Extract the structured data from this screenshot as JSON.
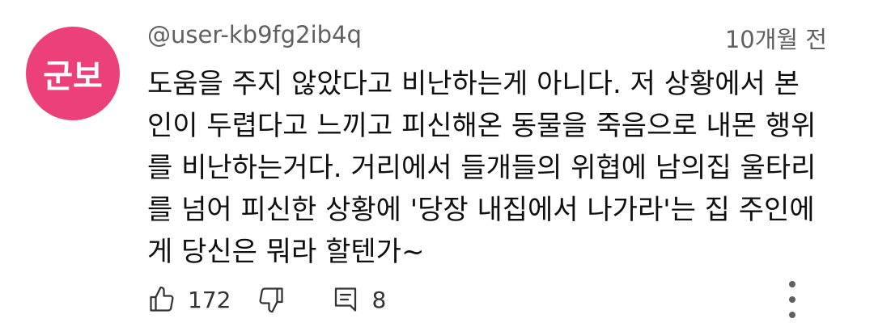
{
  "comment": {
    "avatar_text": "군보",
    "author": "@user-kb9fg2ib4q",
    "timestamp": "10개월 전",
    "lines": [
      "도움을 주지 않았다고 비난하는게 아니다. 저 상황에서 본",
      "인이 두렵다고 느끼고 피신해온 동물을 죽음으로 내몬 행위",
      "를 비난하는거다. 거리에서 들개들의 위협에 남의집 울타리",
      "를 넘어 피신한 상황에 '당장 내집에서 나가라'는 집 주인에",
      "게 당신은 뭐라 할텐가~"
    ],
    "like_count": "172",
    "reply_count": "8"
  },
  "colors": {
    "avatar_bg": "#ec407a",
    "meta_text": "#606060",
    "body_text": "#0f0f0f"
  },
  "icons": {
    "like": "thumbs-up-icon",
    "dislike": "thumbs-down-icon",
    "reply": "comment-reply-icon",
    "more": "kebab-menu-icon"
  }
}
